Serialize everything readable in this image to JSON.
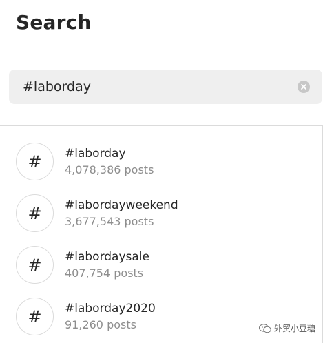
{
  "header": {
    "title": "Search"
  },
  "search": {
    "value": "#laborday"
  },
  "results": [
    {
      "symbol": "#",
      "tag": "#laborday",
      "posts": "4,078,386 posts"
    },
    {
      "symbol": "#",
      "tag": "#labordayweekend",
      "posts": "3,677,543 posts"
    },
    {
      "symbol": "#",
      "tag": "#labordaysale",
      "posts": "407,754 posts"
    },
    {
      "symbol": "#",
      "tag": "#laborday2020",
      "posts": "91,260 posts"
    }
  ],
  "watermark": {
    "text": "外贸小豆糖",
    "icon": "wechat-icon"
  },
  "colors": {
    "search_bg": "#efefef",
    "muted_text": "#8e8e8e",
    "border": "#dbdbdb"
  }
}
